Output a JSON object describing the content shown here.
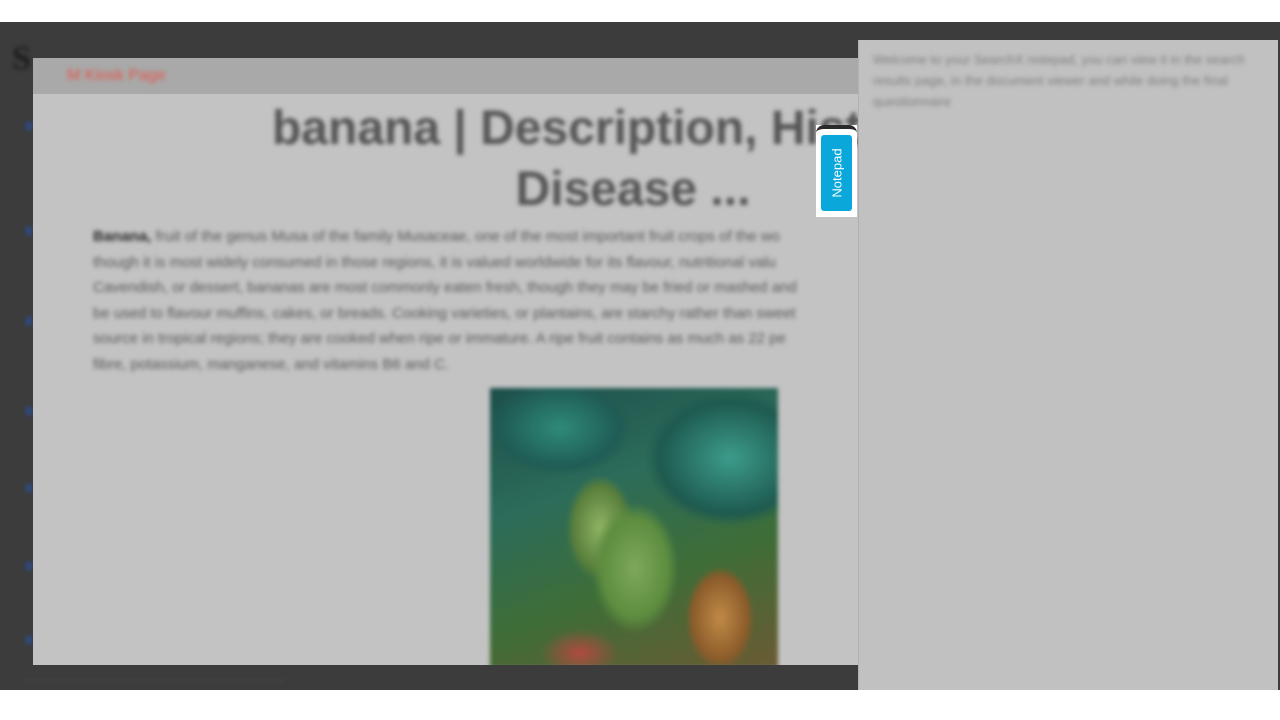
{
  "background_page": {
    "logo_glyph": "S"
  },
  "doc_viewer": {
    "kiosk_link_label": "M Kiosk Page",
    "title_lines": [
      "banana | Description, History, C",
      "Disease ..."
    ],
    "body": {
      "lead": "Banana,",
      "line1": " fruit of the genus Musa of the family Musaceae, one of the most important fruit crops of the wo",
      "line2": "though it is most widely consumed in those regions, it is valued worldwide for its flavour, nutritional valu",
      "line3": "Cavendish, or dessert, bananas are most commonly eaten fresh, though they may be fried or mashed and",
      "line4": "be used to flavour muffins, cakes, or breads. Cooking varieties, or plantains, are starchy rather than sweet",
      "line5": "source in tropical regions; they are cooked when ripe or immature. A ripe fruit contains as much as 22 pe",
      "line6": "fibre, potassium, manganese, and vitamins B6 and C."
    },
    "image_icon": "banana-photo"
  },
  "notepad": {
    "tab_label": "Notepad",
    "content": "Welcome to your SearchX notepad, you can view it in the search results page, in the document viewer and while doing the final questionnaire"
  },
  "status_strip": {
    "text": "......................................................................................"
  },
  "colors": {
    "overlay": "#3c3c3c",
    "viewer_bg": "#c3c3c3",
    "toolbar_bg": "#a9a9a9",
    "kiosk_link": "#e2574c",
    "notepad_tab": "#0aa7db",
    "notepad_panel": "#c1c1c1"
  }
}
